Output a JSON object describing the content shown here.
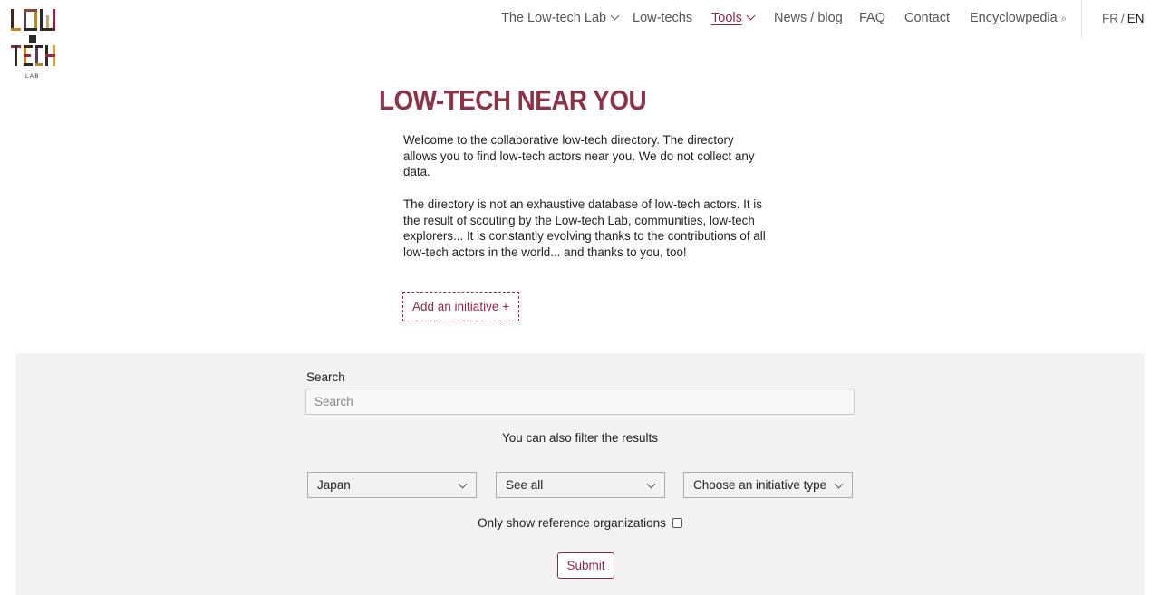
{
  "logo": {
    "alt": "Low-tech Lab logo",
    "sub": "LAB"
  },
  "nav": {
    "items": [
      {
        "label": "The Low-tech Lab",
        "has_dropdown": true
      },
      {
        "label": "Low-techs",
        "has_dropdown": false
      },
      {
        "label": "Tools",
        "has_dropdown": true,
        "active": true
      },
      {
        "label": "News / blog",
        "has_dropdown": false
      },
      {
        "label": "FAQ",
        "has_dropdown": false
      },
      {
        "label": "Contact",
        "has_dropdown": false
      },
      {
        "label": "Encyclowpedia",
        "has_dropdown": false,
        "icon": "search-icon"
      }
    ],
    "lang": {
      "fr": "FR",
      "separator": "/",
      "en": "EN",
      "current": "EN"
    }
  },
  "hero": {
    "title": "LOW-TECH NEAR YOU",
    "paragraph1": "Welcome to the collaborative low-tech directory. The directory allows you to find low-tech actors near you. We do not collect any data.",
    "paragraph2": "The directory is not an exhaustive database of low-tech actors. It is the result of scouting by the Low-tech Lab, communities, low-tech explorers... It is constantly evolving thanks to the contributions of all low-tech actors in the world... and thanks to you, too!",
    "add_button": "Add an initiative +"
  },
  "filters": {
    "search_label": "Search",
    "search_placeholder": "Search",
    "search_value": "",
    "hint": "You can also filter the results",
    "country": "Japan",
    "category": "See all",
    "initiative_type": "Choose an initiative type",
    "reference_label": "Only show reference organizations",
    "reference_checked": false,
    "submit": "Submit"
  },
  "colors": {
    "accent": "#8a2a44",
    "title": "#8a3349",
    "panel_bg": "#f3f1f2"
  }
}
